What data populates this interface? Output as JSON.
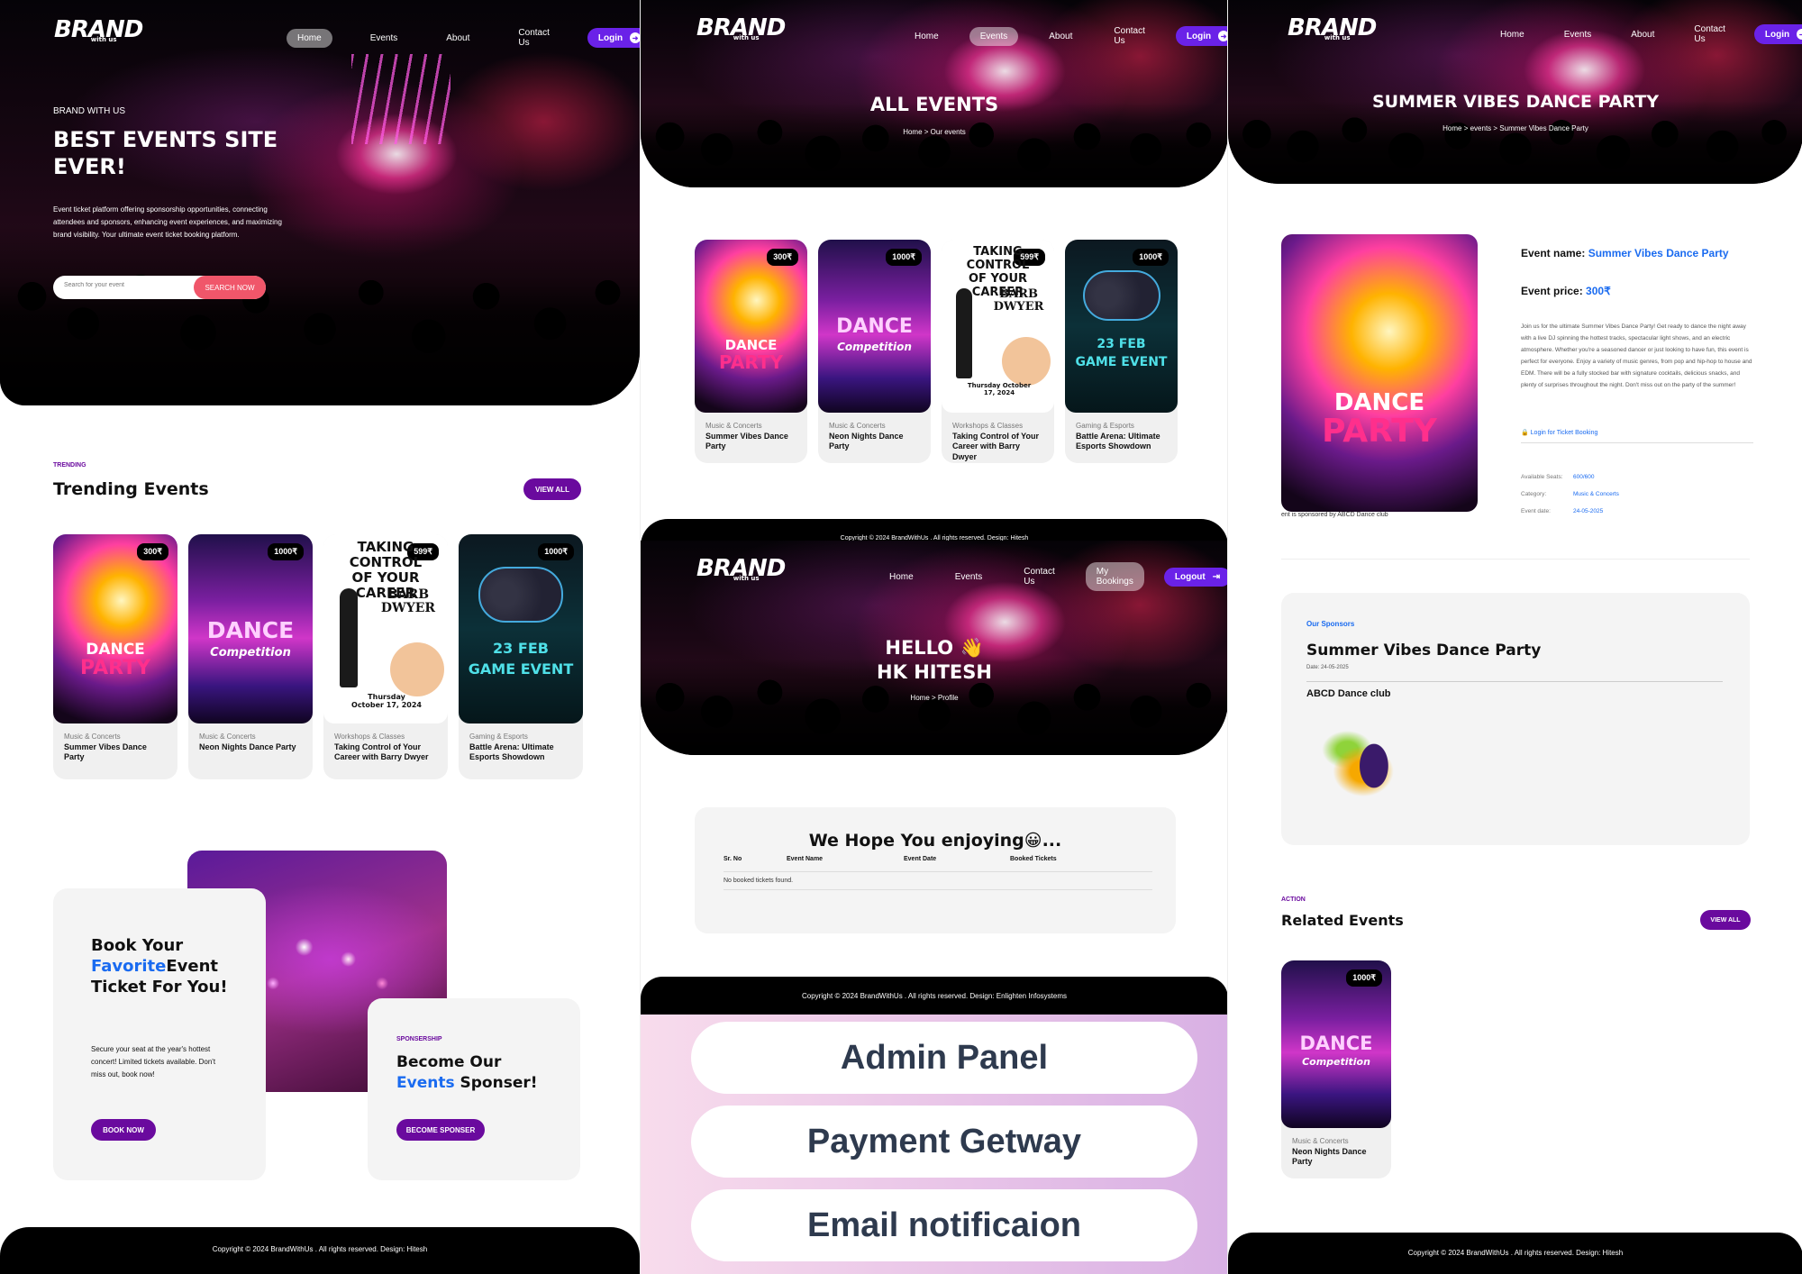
{
  "brand": {
    "name": "BRAND",
    "tag": "with us"
  },
  "home": {
    "nav": [
      "Home",
      "Events",
      "About",
      "Contact Us"
    ],
    "login": "Login",
    "hero_kicker": "BRAND WITH US",
    "hero_title_1": "BEST EVENTS SITE",
    "hero_title_2": "EVER!",
    "hero_desc": "Event ticket platform offering sponsorship opportunities, connecting attendees and sponsors, enhancing event experiences, and maximizing brand visibility. Your ultimate event ticket booking platform.",
    "search_placeholder": "Search for your event",
    "search_button": "SEARCH NOW",
    "trending_tag": "TRENDING",
    "trending_title": "Trending Events",
    "view_all": "VIEW ALL",
    "book_title_1": "Book Your",
    "book_title_fav": "Favorite",
    "book_title_2": "Event Ticket For You!",
    "book_desc": "Secure your seat at the year's hottest concert! Limited tickets available. Don't miss out, book now!",
    "book_button": "BOOK NOW",
    "spon_tag": "SPONSERSHIP",
    "spon_title_1": "Become Our",
    "spon_title_events": "Events",
    "spon_title_2": "Sponser!",
    "spon_button": "BECOME SPONSER",
    "footer": "Copyright © 2024 BrandWithUs . All rights reserved.  Design: Hitesh"
  },
  "events": [
    {
      "price": "300₹",
      "category": "Music & Concerts",
      "title": "Summer Vibes Dance Party",
      "poster": "dance"
    },
    {
      "price": "1000₹",
      "category": "Music & Concerts",
      "title": "Neon Nights Dance Party",
      "poster": "neon"
    },
    {
      "price": "599₹",
      "category": "Workshops & Classes",
      "title": "Taking Control of Your Career with Barry Dwyer",
      "poster": "work"
    },
    {
      "price": "1000₹",
      "category": "Gaming & Esports",
      "title": "Battle Arena: Ultimate Esports Showdown",
      "poster": "game"
    }
  ],
  "posters": {
    "dance_1": "DANCE",
    "dance_2": "PARTY",
    "neon_1": "DANCE",
    "neon_2": "Competition",
    "work_1": "TAKING CONTROL",
    "work_2": "OF YOUR CAREER",
    "work_3": "BARB",
    "work_4": "DWYER",
    "work_date": "Thursday October 17, 2024",
    "game_1": "23 FEB",
    "game_2": "GAME EVENT"
  },
  "all_events": {
    "nav": [
      "Home",
      "Events",
      "About",
      "Contact Us"
    ],
    "login": "Login",
    "title": "ALL EVENTS",
    "crumb": "Home > Our events",
    "footer_peek": "Copyright © 2024 BrandWithUs . All rights reserved.  Design: Hitesh"
  },
  "profile": {
    "nav": [
      "Home",
      "Events",
      "Contact Us",
      "My Bookings"
    ],
    "logout": "Logout",
    "greet_1": "HELLO 👋",
    "greet_2": "HK HITESH",
    "crumb": "Home > Profile",
    "box_title": "We Hope You enjoying😀...",
    "columns": [
      "Sr. No",
      "Event Name",
      "Event Date",
      "Booked Tickets"
    ],
    "empty": "No booked tickets found.",
    "footer": "Copyright © 2024 BrandWithUs . All rights reserved.  Design: Enlighten Infosystems"
  },
  "features": [
    "Admin Panel",
    "Payment Getway",
    "Email notificaion"
  ],
  "detail": {
    "nav": [
      "Home",
      "Events",
      "About",
      "Contact Us"
    ],
    "login": "Login",
    "title": "SUMMER VIBES DANCE PARTY",
    "crumb": "Home > events > Summer Vibes Dance Party",
    "name_label": "Event name:",
    "name_value": "Summer Vibes Dance Party",
    "price_label": "Event price:",
    "price_value": "300₹",
    "desc": "Join us for the ultimate Summer Vibes Dance Party! Get ready to dance the night away with a live DJ spinning the hottest tracks, spectacular light shows, and an electric atmosphere. Whether you're a seasoned dancer or just looking to have fun, this event is perfect for everyone. Enjoy a variety of music genres, from pop and hip-hop to house and EDM. There will be a fully stocked bar with signature cocktails, delicious snacks, and plenty of surprises throughout the night. Don't miss out on the party of the summer!",
    "login_link": "🔒 Login for Ticket Booking",
    "seats_label": "Available Seats:",
    "seats_value": "600/600",
    "category_label": "Category:",
    "category_value": "Music & Concerts",
    "date_label": "Event date:",
    "date_value": "24-05-2025",
    "sponsored_by": "ent is sponsored by ABCD Dance club",
    "sponsors_tag": "Our Sponsors",
    "sponsors_event": "Summer Vibes Dance Party",
    "sponsors_date": "Date: 24-05-2025",
    "sponsor_name": "ABCD Dance club",
    "related_tag": "ACTION",
    "related_title": "Related Events",
    "view_all": "VIEW ALL",
    "related": {
      "price": "1000₹",
      "category": "Music & Concerts",
      "title": "Neon Nights Dance Party"
    },
    "footer": "Copyright © 2024 BrandWithUs . All rights reserved.  Design: Hitesh"
  },
  "colors": {
    "accent": "#6a22e8",
    "purple": "#6a0a9e",
    "blue": "#1a6bf0",
    "search": "#f0566a"
  }
}
